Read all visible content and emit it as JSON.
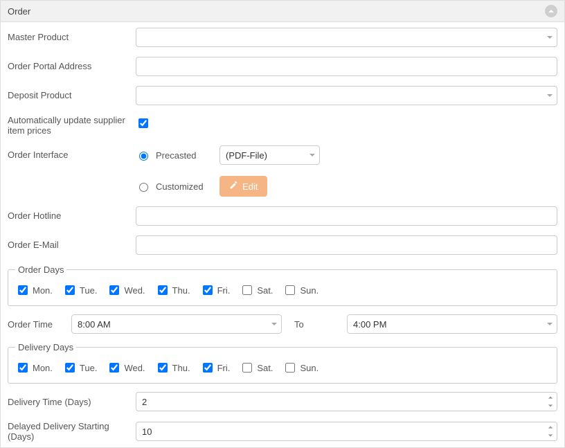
{
  "panel": {
    "title": "Order"
  },
  "labels": {
    "masterProduct": "Master Product",
    "orderPortal": "Order Portal Address",
    "depositProduct": "Deposit Product",
    "autoUpdate": "Automatically update supplier item prices",
    "orderInterface": "Order Interface",
    "precasted": "Precasted",
    "customized": "Customized",
    "orderHotline": "Order Hotline",
    "orderEmail": "Order E-Mail",
    "orderDays": "Order Days",
    "orderTime": "Order Time",
    "to": "To",
    "deliveryDays": "Delivery Days",
    "deliveryTime": "Delivery Time (Days)",
    "delayedDelivery": "Delayed Delivery Starting (Days)"
  },
  "values": {
    "masterProduct": "",
    "orderPortal": "",
    "depositProduct": "",
    "autoUpdate": true,
    "interfaceMode": "precasted",
    "precastedFormat": "(PDF-File)",
    "editLabel": "Edit",
    "orderHotline": "",
    "orderEmail": "",
    "orderTimeFrom": "8:00 AM",
    "orderTimeTo": "4:00 PM",
    "deliveryTime": "2",
    "delayedDelivery": "10"
  },
  "days": {
    "order": [
      {
        "label": "Mon.",
        "checked": true
      },
      {
        "label": "Tue.",
        "checked": true
      },
      {
        "label": "Wed.",
        "checked": true
      },
      {
        "label": "Thu.",
        "checked": true
      },
      {
        "label": "Fri.",
        "checked": true
      },
      {
        "label": "Sat.",
        "checked": false
      },
      {
        "label": "Sun.",
        "checked": false
      }
    ],
    "delivery": [
      {
        "label": "Mon.",
        "checked": true
      },
      {
        "label": "Tue.",
        "checked": true
      },
      {
        "label": "Wed.",
        "checked": true
      },
      {
        "label": "Thu.",
        "checked": true
      },
      {
        "label": "Fri.",
        "checked": true
      },
      {
        "label": "Sat.",
        "checked": false
      },
      {
        "label": "Sun.",
        "checked": false
      }
    ]
  }
}
